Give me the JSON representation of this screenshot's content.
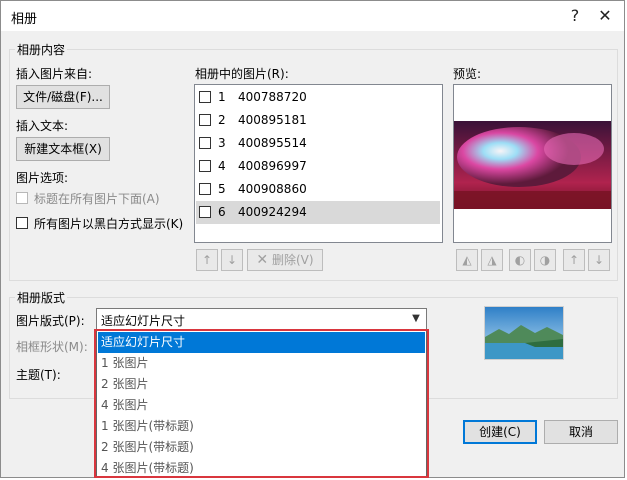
{
  "window": {
    "title": "相册",
    "help": "?",
    "close": "✕"
  },
  "content_group": {
    "title": "相册内容",
    "insert_picture_from": "插入图片来自:",
    "file_disk_button": "文件/磁盘(F)...",
    "insert_text": "插入文本:",
    "new_textbox_button": "新建文本框(X)",
    "picture_options": "图片选项:",
    "captions_below": "标题在所有图片下面(A)",
    "black_white": "所有图片以黑白方式显示(K)",
    "pictures_in_album_label": "相册中的图片(R):",
    "pictures": [
      {
        "num": "1",
        "name": "400788720"
      },
      {
        "num": "2",
        "name": "400895181"
      },
      {
        "num": "3",
        "name": "400895514"
      },
      {
        "num": "4",
        "name": "400896997"
      },
      {
        "num": "5",
        "name": "400908860"
      },
      {
        "num": "6",
        "name": "400924294"
      }
    ],
    "move_up": "↑",
    "move_down": "↓",
    "remove_button": "删除(V)",
    "preview_label": "预览:"
  },
  "layout_group": {
    "title": "相册版式",
    "picture_layout_label": "图片版式(P):",
    "picture_layout_value": "适应幻灯片尺寸",
    "frame_shape_label": "相框形状(M):",
    "theme_label": "主题(T):",
    "dropdown_options": [
      "适应幻灯片尺寸",
      "1 张图片",
      "2 张图片",
      "4 张图片",
      "1 张图片(带标题)",
      "2 张图片(带标题)",
      "4 张图片(带标题)"
    ]
  },
  "footer": {
    "create_button": "创建(C)",
    "cancel_button": "取消"
  },
  "colors": {
    "selection": "#0078d7",
    "highlight_frame": "#d9363e"
  }
}
